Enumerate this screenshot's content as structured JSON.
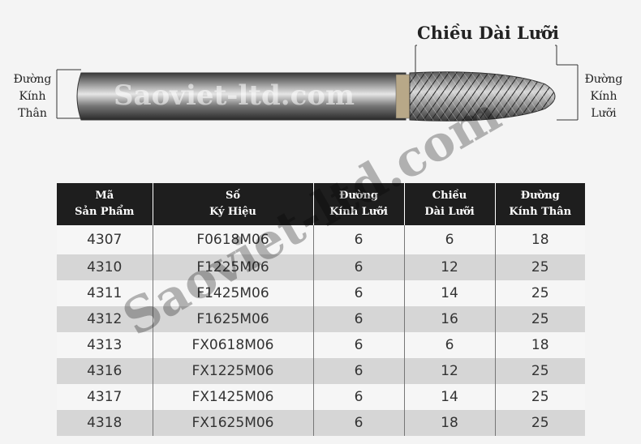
{
  "diagram": {
    "blade_length_label": "Chiều Dài Lưỡi",
    "shank_diameter_label": "Đường\nKính\nThân",
    "blade_diameter_label": "Đường\nKính\nLưỡi",
    "watermark": "Saoviet-ltd.com"
  },
  "table": {
    "headers": [
      "Mã\nSản Phẩm",
      "Số\nKý Hiệu",
      "Đường\nKính Lưỡi",
      "Chiều\nDài Lưỡi",
      "Đường\nKính Thân"
    ],
    "rows": [
      [
        "4307",
        "F0618M06",
        "6",
        "6",
        "18"
      ],
      [
        "4310",
        "F1225M06",
        "6",
        "12",
        "25"
      ],
      [
        "4311",
        "F1425M06",
        "6",
        "14",
        "25"
      ],
      [
        "4312",
        "F1625M06",
        "6",
        "16",
        "25"
      ],
      [
        "4313",
        "FX0618M06",
        "6",
        "6",
        "18"
      ],
      [
        "4316",
        "FX1225M06",
        "6",
        "12",
        "25"
      ],
      [
        "4317",
        "FX1425M06",
        "6",
        "14",
        "25"
      ],
      [
        "4318",
        "FX1625M06",
        "6",
        "18",
        "25"
      ]
    ],
    "watermark": "Saoviet-ltd.com"
  }
}
